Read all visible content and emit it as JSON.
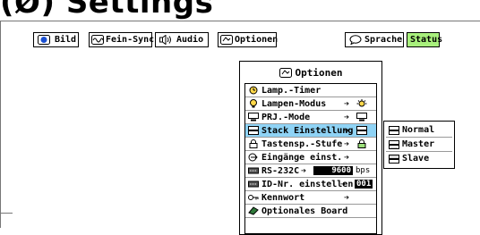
{
  "page": {
    "heading": "(Ø) Settings"
  },
  "toolbar": {
    "buttons": [
      {
        "label": "Bild",
        "icon": "bild-icon"
      },
      {
        "label": "Fein-Sync.",
        "icon": "fein-sync-icon"
      },
      {
        "label": "Audio",
        "icon": "speaker-icon"
      },
      {
        "label": "Optionen",
        "icon": "optionen-icon"
      },
      {
        "label": "Sprache",
        "icon": "speech-bubble-icon"
      },
      {
        "label": "Status",
        "icon": ""
      }
    ]
  },
  "menu": {
    "title": "Optionen",
    "items": [
      {
        "label": "Lamp.-Timer",
        "icon": "lamp-timer-icon"
      },
      {
        "label": "Lampen-Modus",
        "icon": "lamp-icon",
        "arrow": "➔"
      },
      {
        "label": "PRJ.-Mode",
        "icon": "prj-mode-icon",
        "arrow": "➔"
      },
      {
        "label": "Stack Einstellung",
        "icon": "stack-icon",
        "arrow": "➔",
        "selected": true
      },
      {
        "label": "Tastensp.-Stufe",
        "icon": "lock-icon",
        "arrow": "➔"
      },
      {
        "label": "Eingänge einst.",
        "icon": "input-icon",
        "arrow": "➔"
      },
      {
        "label": "RS-232C",
        "icon": "rs232-icon",
        "arrow": "➔",
        "value": "9600",
        "unit": "bps"
      },
      {
        "label": "ID-Nr. einstellen",
        "icon": "id-icon",
        "arrow": "➔",
        "value": "001"
      },
      {
        "label": "Kennwort",
        "icon": "key-icon",
        "arrow": "➔"
      },
      {
        "label": "Optionales Board",
        "icon": "board-icon"
      }
    ]
  },
  "submenu": {
    "items": [
      {
        "label": "Normal",
        "icon": "normal-stack-icon"
      },
      {
        "label": "Master",
        "icon": "master-stack-icon"
      },
      {
        "label": "Slave",
        "icon": "slave-stack-icon"
      }
    ]
  },
  "colors": {
    "selected": "#8fd3f5",
    "status": "#a8f07c"
  }
}
